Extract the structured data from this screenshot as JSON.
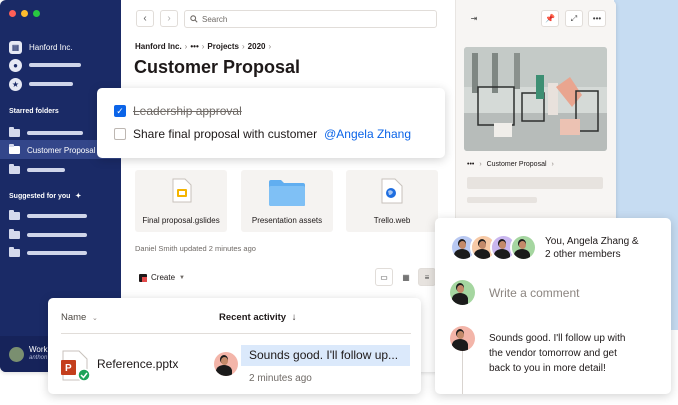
{
  "window": {
    "traffic_colors": [
      "#ff5f57",
      "#febc2e",
      "#28c840"
    ]
  },
  "sidebar": {
    "org_name": "Hanford Inc.",
    "starred_heading": "Starred folders",
    "starred_selected": "Customer Proposal",
    "suggested_heading": "Suggested for you",
    "footer_label": "Work",
    "footer_sub": "anthon"
  },
  "toolbar": {
    "back_glyph": "‹",
    "forward_glyph": "›",
    "search_placeholder": "Search"
  },
  "breadcrumb": {
    "root": "Hanford Inc.",
    "ellipsis": "•••",
    "projects": "Projects",
    "year": "2020"
  },
  "page": {
    "title": "Customer Proposal",
    "updated": "Daniel Smith updated 2 minutes ago",
    "create_label": "Create"
  },
  "tasks": [
    {
      "label": "Leadership approval",
      "done": true
    },
    {
      "label": "Share final proposal with customer",
      "mention": "@Angela Zhang",
      "done": false
    }
  ],
  "files": [
    {
      "name": "Final proposal.gslides",
      "icon": "slides-file-icon"
    },
    {
      "name": "Presentation assets",
      "icon": "folder-icon"
    },
    {
      "name": "Trello.web",
      "icon": "web-link-icon"
    }
  ],
  "right_panel": {
    "crumb_ellipsis": "•••",
    "crumb_label": "Customer Proposal"
  },
  "file_list": {
    "col_name": "Name",
    "col_activity": "Recent activity",
    "rows": [
      {
        "name": "Reference.pptx",
        "activity": "Sounds good. I'll follow up...",
        "time": "2 minutes ago"
      }
    ]
  },
  "comments": {
    "members": "You, Angela Zhang & 2 other members",
    "members_line1": "You, Angela Zhang &",
    "members_line2": "2 other members",
    "placeholder": "Write a comment",
    "message": "Sounds good. I'll follow up with the vendor tomorrow and get back to you in more detail!",
    "message_line1": "Sounds good. I'll follow up with",
    "message_line2": "the vendor tomorrow and get",
    "message_line3": "back to you in more detail!"
  },
  "colors": {
    "sidebar": "#1a2a66",
    "accent": "#0b64e8",
    "backdrop": "#c6dcf2"
  }
}
